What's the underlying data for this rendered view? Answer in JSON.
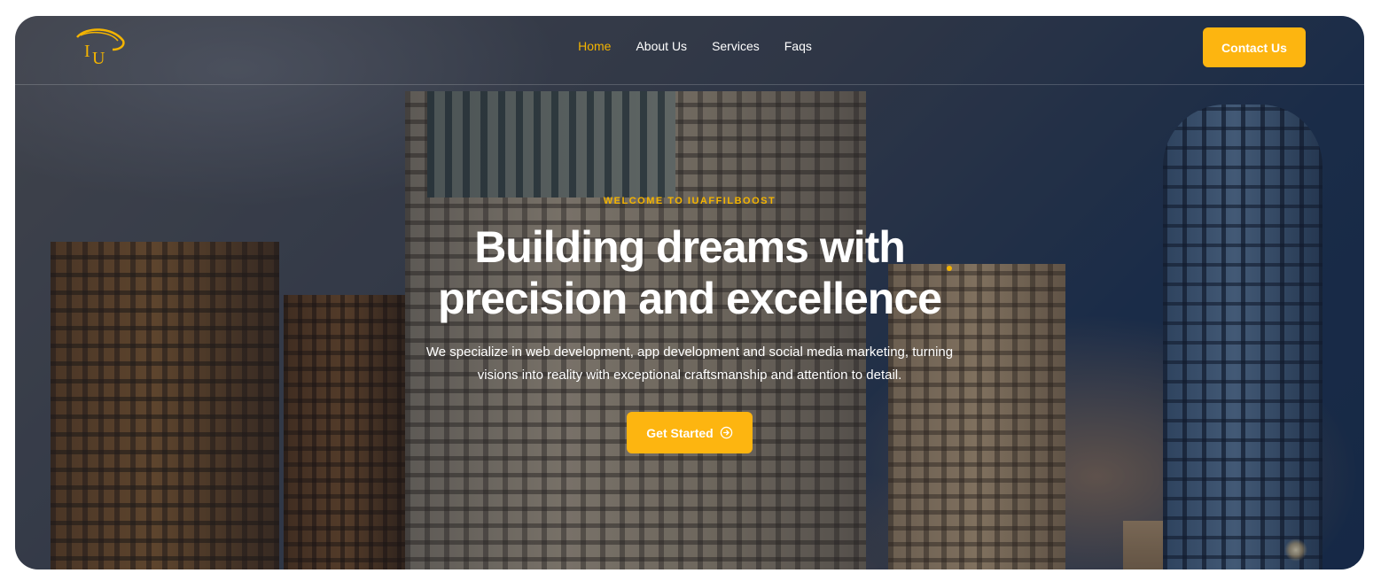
{
  "brand": {
    "logo_letters": "IU",
    "accent_color": "#fdb510"
  },
  "nav": {
    "items": [
      {
        "label": "Home",
        "active": true
      },
      {
        "label": "About Us",
        "active": false
      },
      {
        "label": "Services",
        "active": false
      },
      {
        "label": "Faqs",
        "active": false
      }
    ],
    "contact_label": "Contact Us"
  },
  "hero": {
    "eyebrow": "WELCOME TO IUAFFILBOOST",
    "headline_line1": "Building dreams with",
    "headline_line2": "precision and excellence",
    "subtext_line1": "We specialize in web development, app development and social media marketing, turning",
    "subtext_line2": "visions into reality with exceptional craftsmanship and attention to detail.",
    "cta_label": "Get Started",
    "cta_icon": "arrow-circle-right-icon",
    "background": "city-skyline-at-dusk"
  }
}
